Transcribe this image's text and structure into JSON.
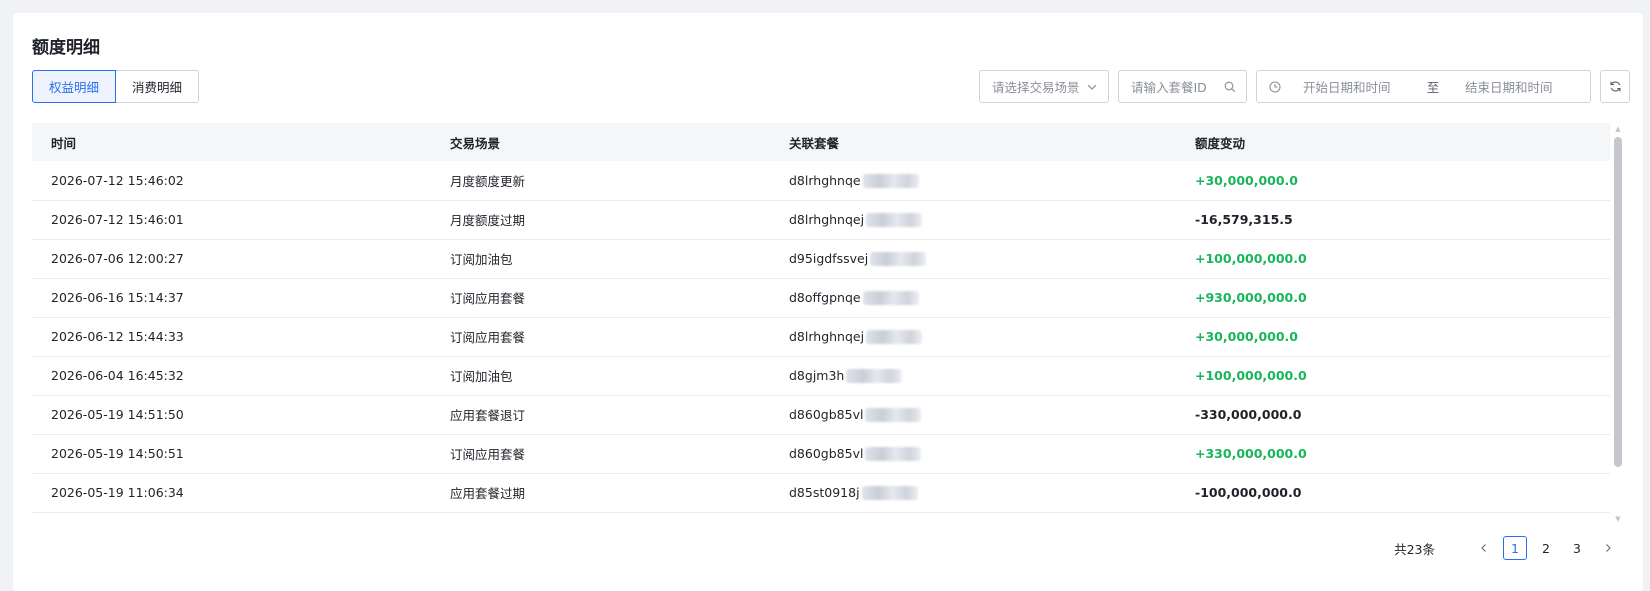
{
  "page": {
    "title": "额度明细"
  },
  "tabs": [
    {
      "label": "权益明细",
      "active": true
    },
    {
      "label": "消费明细",
      "active": false
    }
  ],
  "filters": {
    "scene_placeholder": "请选择交易场景",
    "package_placeholder": "请输入套餐ID",
    "start_placeholder": "开始日期和时间",
    "range_separator": "至",
    "end_placeholder": "结束日期和时间"
  },
  "table": {
    "headers": [
      "时间",
      "交易场景",
      "关联套餐",
      "额度变动"
    ],
    "rows": [
      {
        "time": "2026-07-12 15:46:02",
        "scene": "月度额度更新",
        "package": "d8lrhghnqe",
        "change": "+30,000,000.0",
        "positive": true
      },
      {
        "time": "2026-07-12 15:46:01",
        "scene": "月度额度过期",
        "package": "d8lrhghnqej",
        "change": "-16,579,315.5",
        "positive": false
      },
      {
        "time": "2026-07-06 12:00:27",
        "scene": "订阅加油包",
        "package": "d95igdfssvej",
        "change": "+100,000,000.0",
        "positive": true
      },
      {
        "time": "2026-06-16 15:14:37",
        "scene": "订阅应用套餐",
        "package": "d8offgpnqe",
        "change": "+930,000,000.0",
        "positive": true
      },
      {
        "time": "2026-06-12 15:44:33",
        "scene": "订阅应用套餐",
        "package": "d8lrhghnqej",
        "change": "+30,000,000.0",
        "positive": true
      },
      {
        "time": "2026-06-04 16:45:32",
        "scene": "订阅加油包",
        "package": "d8gjm3h",
        "change": "+100,000,000.0",
        "positive": true
      },
      {
        "time": "2026-05-19 14:51:50",
        "scene": "应用套餐退订",
        "package": "d860gb85vl",
        "change": "-330,000,000.0",
        "positive": false
      },
      {
        "time": "2026-05-19 14:50:51",
        "scene": "订阅应用套餐",
        "package": "d860gb85vl",
        "change": "+330,000,000.0",
        "positive": true
      },
      {
        "time": "2026-05-19 11:06:34",
        "scene": "应用套餐过期",
        "package": "d85st0918j",
        "change": "-100,000,000.0",
        "positive": false
      }
    ]
  },
  "pagination": {
    "total_text": "共23条",
    "pages": [
      "1",
      "2",
      "3"
    ],
    "current": "1"
  },
  "colors": {
    "accent": "#2b6ff0",
    "positive": "#19b55a",
    "negative": "#1f2329"
  }
}
